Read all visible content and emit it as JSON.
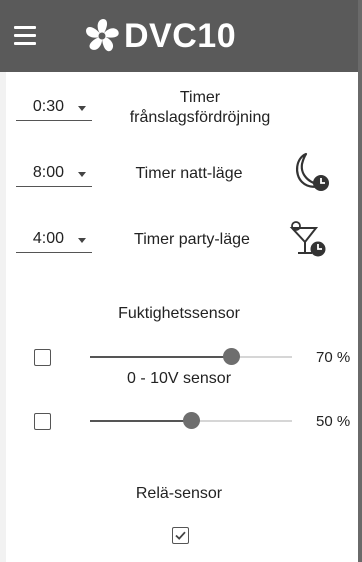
{
  "app": {
    "title": "DVC10"
  },
  "timers": [
    {
      "value": "0:30",
      "label_line1": "Timer",
      "label_line2": "frånslagsfördröjning",
      "icon": ""
    },
    {
      "value": "8:00",
      "label_line1": "Timer natt-läge",
      "label_line2": "",
      "icon": "moon-clock-icon"
    },
    {
      "value": "4:00",
      "label_line1": "Timer party-läge",
      "label_line2": "",
      "icon": "cocktail-clock-icon"
    }
  ],
  "sensors": [
    {
      "label": "Fuktighetssensor",
      "checked": false,
      "value_percent": 70,
      "value_text": "70 %"
    },
    {
      "label": "0 - 10V sensor",
      "checked": false,
      "value_percent": 50,
      "value_text": "50 %"
    },
    {
      "label": "Relä-sensor",
      "checked": true
    }
  ],
  "colors": {
    "appbar": "#5a5a5a",
    "accent": "#6e6e6e"
  }
}
